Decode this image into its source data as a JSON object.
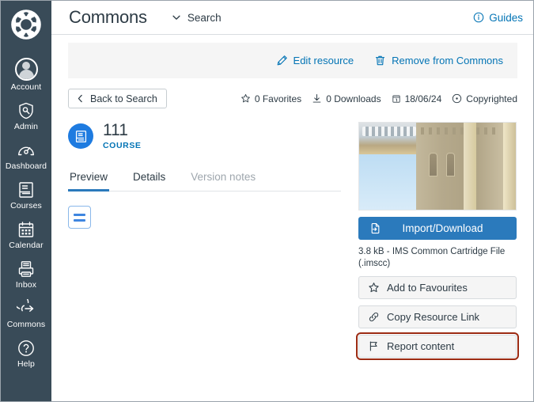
{
  "colors": {
    "nav_bg": "#394B58",
    "brand_blue": "#0374B5",
    "button_blue": "#2B7ABC",
    "badge_blue": "#1E7BE0",
    "text_dark": "#2D3B45",
    "focus_red": "#9C2B13",
    "strip_grey": "#F5F5F5"
  },
  "globalnav": {
    "logo_name": "canvas-logo",
    "items": [
      {
        "label": "Account",
        "icon": "user-avatar-icon"
      },
      {
        "label": "Admin",
        "icon": "shield-icon"
      },
      {
        "label": "Dashboard",
        "icon": "gauge-icon"
      },
      {
        "label": "Courses",
        "icon": "book-icon"
      },
      {
        "label": "Calendar",
        "icon": "calendar-icon"
      },
      {
        "label": "Inbox",
        "icon": "inbox-icon"
      },
      {
        "label": "Commons",
        "icon": "commons-share-icon"
      },
      {
        "label": "Help",
        "icon": "question-circle-icon"
      }
    ]
  },
  "topbar": {
    "title": "Commons",
    "search_label": "Search",
    "search_chevron": "chevron-down-icon",
    "guides_label": "Guides",
    "guides_icon": "info-circle-icon"
  },
  "action_strip": {
    "edit_label": "Edit resource",
    "edit_icon": "pencil-icon",
    "remove_label": "Remove from Commons",
    "remove_icon": "trash-icon"
  },
  "back_row": {
    "back_label": "Back to Search",
    "back_icon": "chevron-left-icon",
    "meta": [
      {
        "icon": "star-outline-icon",
        "text": "0 Favorites"
      },
      {
        "icon": "download-icon",
        "text": "0 Downloads"
      },
      {
        "icon": "calendar-day-icon",
        "text": "18/06/24"
      },
      {
        "icon": "copyright-icon",
        "text": "Copyrighted"
      }
    ]
  },
  "resource": {
    "badge_icon": "course-book-icon",
    "title": "111",
    "type": "COURSE"
  },
  "tabs": [
    {
      "label": "Preview",
      "state": "active"
    },
    {
      "label": "Details",
      "state": "normal"
    },
    {
      "label": "Version notes",
      "state": "muted"
    }
  ],
  "preview": {
    "module_icon": "module-list-icon"
  },
  "sidebar_panel": {
    "thumbnail_name": "resource-thumbnail",
    "import_label": "Import/Download",
    "import_icon": "import-file-icon",
    "file_info": "3.8 kB - IMS Common Cartridge File (.imscc)",
    "buttons": [
      {
        "label": "Add to Favourites",
        "icon": "star-outline-icon",
        "focused": false
      },
      {
        "label": "Copy Resource Link",
        "icon": "link-icon",
        "focused": false
      },
      {
        "label": "Report content",
        "icon": "flag-icon",
        "focused": true
      }
    ]
  }
}
